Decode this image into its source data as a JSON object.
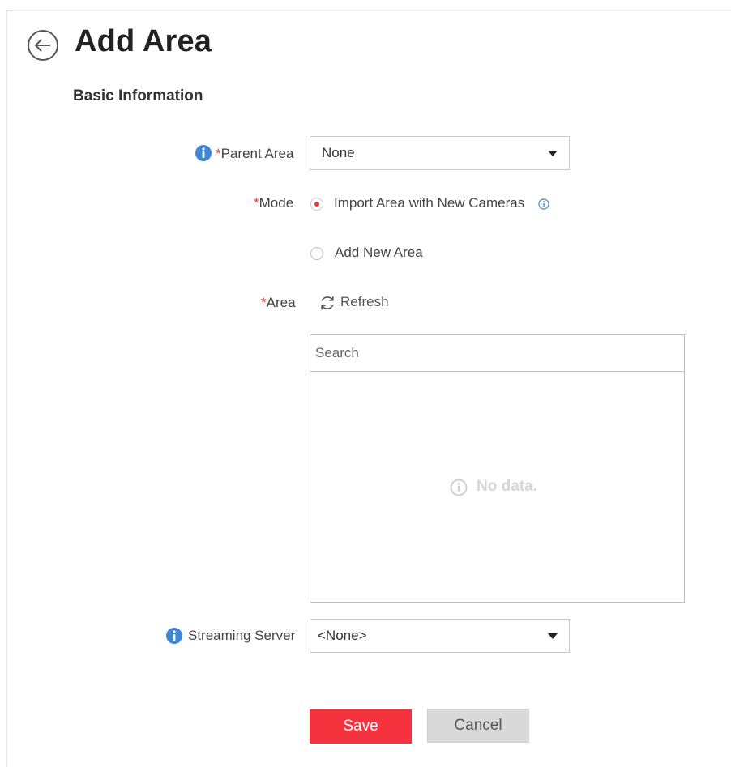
{
  "page": {
    "title": "Add Area",
    "section_title": "Basic Information"
  },
  "form": {
    "parent_area": {
      "label": "Parent Area",
      "required_mark": "*",
      "value": "None"
    },
    "mode": {
      "label": "Mode",
      "required_mark": "*",
      "options": [
        {
          "label": "Import Area with New Cameras",
          "selected": true
        },
        {
          "label": "Add New Area",
          "selected": false
        }
      ]
    },
    "area": {
      "label": "Area",
      "required_mark": "*",
      "refresh_label": "Refresh",
      "search_placeholder": "Search",
      "empty_text": "No data."
    },
    "streaming_server": {
      "label": "Streaming Server",
      "value": "<None>"
    }
  },
  "actions": {
    "save_label": "Save",
    "cancel_label": "Cancel"
  },
  "colors": {
    "primary": "#f5333f",
    "required": "#e53935",
    "info_icon": "#3f86d6",
    "cancel_bg": "#d9d9d9"
  },
  "icons": [
    "back-arrow-icon",
    "info-icon",
    "caret-down-icon",
    "refresh-icon",
    "info-outline-icon"
  ]
}
